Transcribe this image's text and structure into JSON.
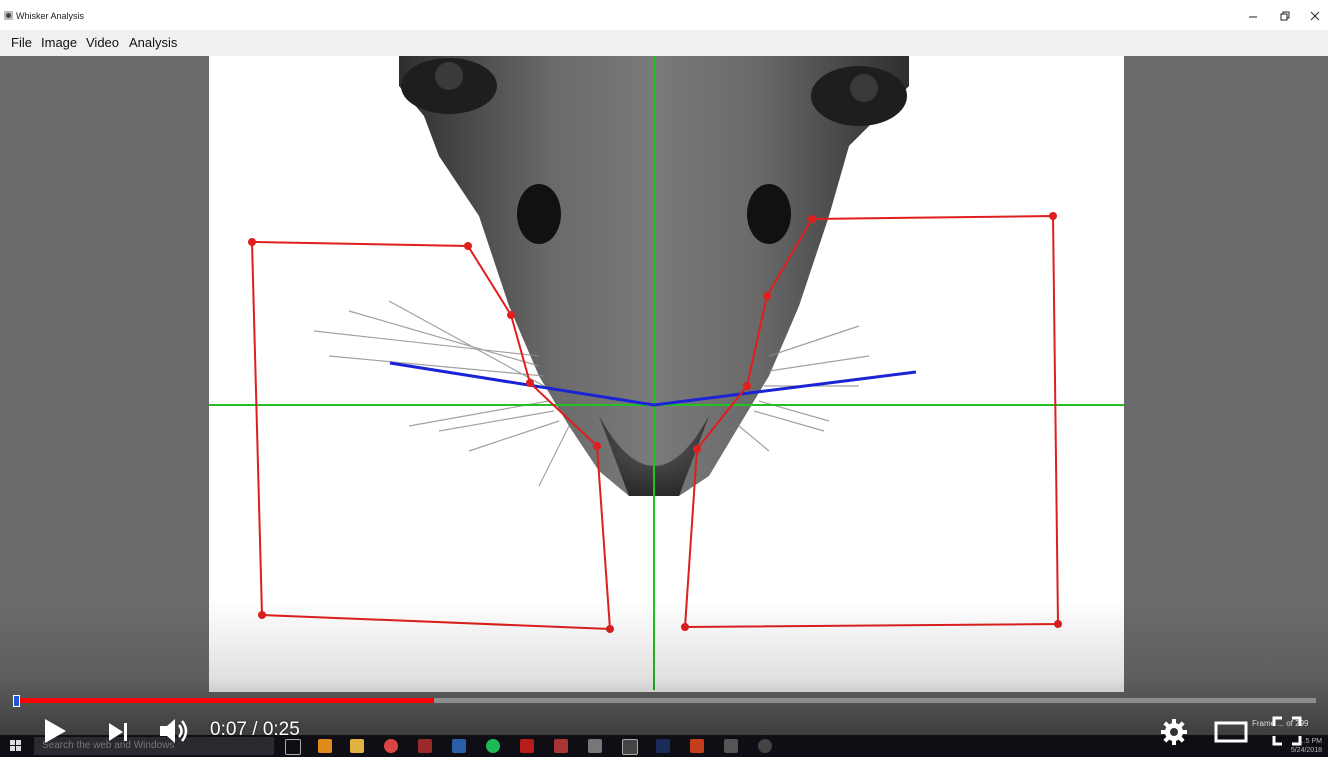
{
  "window": {
    "title": "Whisker Analysis"
  },
  "menu": {
    "items": [
      "File",
      "Image",
      "Video",
      "Analysis"
    ]
  },
  "video_player": {
    "time_current": "0:07",
    "time_total": "0:25",
    "time_label": "0:07 / 0:25",
    "progress_fraction": 0.28,
    "progress_color": "#ff0000"
  },
  "frame_readout": "Frame ... of 299",
  "taskbar": {
    "search_placeholder": "Search the web and Windows",
    "clock_time": "...5 PM",
    "clock_date": "5/24/2018"
  },
  "overlay_colors": {
    "midline": "#22c022",
    "whisker_angle": "#1a23d6",
    "roi": "#e01e1e"
  }
}
